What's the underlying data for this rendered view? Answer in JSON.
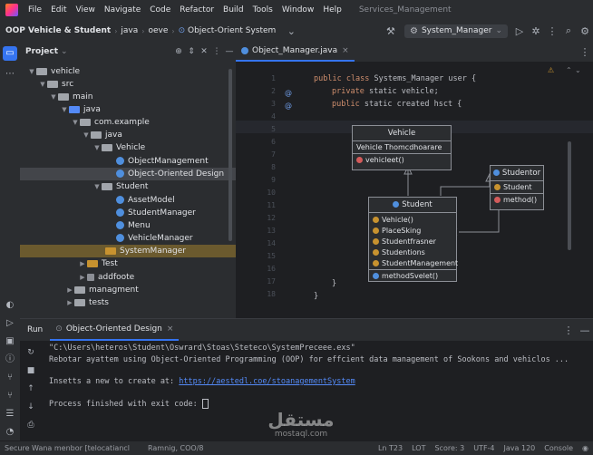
{
  "menubar": {
    "items": [
      "File",
      "Edit",
      "View",
      "Navigate",
      "Code",
      "Refactor",
      "Build",
      "Tools",
      "Window",
      "Help"
    ],
    "window_title": "Services_Management"
  },
  "toolbar": {
    "project": "OOP Vehicle & Student",
    "crumbs": [
      "java",
      "oeve",
      "Object-Orient System"
    ],
    "run_config": "System_Manager"
  },
  "project_pane": {
    "title": "Project",
    "tree": [
      {
        "label": "vehicle",
        "arrow": "v",
        "icon": "folder"
      },
      {
        "label": "src",
        "arrow": "v",
        "icon": "folder"
      },
      {
        "label": "main",
        "arrow": "v",
        "icon": "folder"
      },
      {
        "label": "java",
        "arrow": "v",
        "icon": "folder-blue"
      },
      {
        "label": "com.example",
        "arrow": "v",
        "icon": "folder"
      },
      {
        "label": "java",
        "arrow": "v",
        "icon": "folder"
      },
      {
        "label": "Vehicle",
        "arrow": "v",
        "icon": "folder"
      },
      {
        "label": "ObjectManagement",
        "arrow": "",
        "icon": "class"
      },
      {
        "label": "Object-Oriented Design",
        "arrow": "",
        "icon": "class"
      },
      {
        "label": "Student",
        "arrow": "v",
        "icon": "folder"
      },
      {
        "label": "AssetModel",
        "arrow": "",
        "icon": "class"
      },
      {
        "label": "StudentManager",
        "arrow": "",
        "icon": "class"
      },
      {
        "label": "Menu",
        "arrow": "",
        "icon": "class"
      },
      {
        "label": "VehicleManager",
        "arrow": "",
        "icon": "class"
      },
      {
        "label": "SystemManager",
        "arrow": "",
        "icon": "folder-orange"
      },
      {
        "label": "Test",
        "arrow": ">",
        "icon": "folder-orange"
      },
      {
        "label": "addfoote",
        "arrow": ">",
        "icon": "file"
      },
      {
        "label": "managment",
        "arrow": ">",
        "icon": "folder"
      },
      {
        "label": "tests",
        "arrow": ">",
        "icon": "folder"
      }
    ]
  },
  "editor": {
    "tab": "Object_Manager.java",
    "line_numbers": [
      "1",
      "2",
      "3",
      "4",
      "5",
      "6",
      "7",
      "8",
      "9",
      "10",
      "11",
      "12",
      "13",
      "14",
      "15",
      "16",
      "17",
      "18"
    ],
    "line1": [
      "public class ",
      "Systems_Manager user {"
    ],
    "line2": [
      "private ",
      "static vehicle;"
    ],
    "line3": [
      "public ",
      "static created hsct {"
    ],
    "closing1": "}",
    "closing2": "}"
  },
  "uml": {
    "vehicle": {
      "title": "Vehicle",
      "row1": "Vehicle Thomcdhoarare",
      "row2": "vehicleet()"
    },
    "studentor": {
      "title": "Studentor",
      "row1": "Student",
      "row2": "method()"
    },
    "student": {
      "title": "Student",
      "rows": [
        "Vehicle()",
        "PlaceSking",
        "Studentfrasner",
        "Studentions",
        "StudentManagement"
      ],
      "method": "methodSvelet()"
    }
  },
  "run_panel": {
    "tab_label": "Run",
    "config": "Object-Oriented Design",
    "cmd": "\"C:\\Users\\heteros\\Student\\Oswrard\\Stoas\\Steteco\\SystemPreceee.exs\"",
    "line1": "Rebotar ayattem using Object-Oriented Programming (OOP) for effcient data management of Sookons and vehiclos ...",
    "line2_prefix": "Insetts a new to create at: ",
    "line2_link": "https://aestedl.coe/stoanagementSystem",
    "line3": "Process finished with exit code: "
  },
  "status": {
    "left1": "Secure Wana menbor [telocatiancl",
    "left2": "Ramnig, COO/8",
    "right": [
      "Ln T23",
      "LOT",
      "Score: 3",
      "UTF-4",
      "Java 120",
      "Console"
    ]
  },
  "watermark": {
    "arabic": "مستقل",
    "latin": "mostaql.com"
  }
}
